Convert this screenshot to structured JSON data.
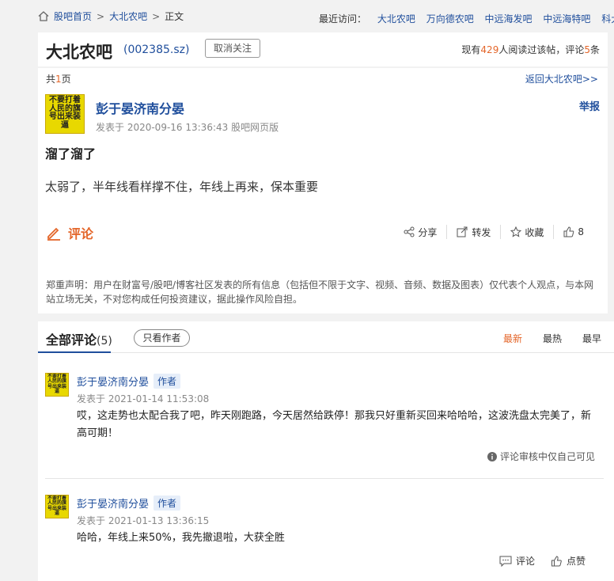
{
  "breadcrumb": {
    "home": "股吧首页",
    "bar": "大北农吧",
    "current": "正文",
    "sep": ">"
  },
  "recent": {
    "label": "最近访问：",
    "items": [
      "大北农吧",
      "万向德农吧",
      "中远海发吧",
      "中远海特吧",
      "科大智能"
    ]
  },
  "header": {
    "title": "大北农吧",
    "code": "(002385.sz)",
    "unfollow": "取消关注",
    "readers_prefix": "现有",
    "readers_count": "429",
    "readers_mid": "人阅读过该帖，评论",
    "comments_count": "5",
    "readers_suffix": "条"
  },
  "post": {
    "pages_prefix": "共",
    "pages_num": "1",
    "pages_suffix": "页",
    "back": "返回大北农吧>>",
    "avatar_text": "不要打着人民的旗号出来装逼",
    "author": "彭于晏济南分晏",
    "report": "举报",
    "posted": "发表于 2020-09-16 13:36:43 股吧网页版",
    "title": "溜了溜了",
    "body": "太弱了，半年线看样撑不住，年线上再来，保本重要",
    "comment": "评论",
    "share": "分享",
    "repost": "转发",
    "collect": "收藏",
    "likes": "8",
    "disclaimer": "郑重声明：用户在财富号/股吧/博客社区发表的所有信息（包括但不限于文字、视频、音频、数据及图表）仅代表个人观点，与本网站立场无关，不对您构成任何投资建议，据此操作风险自担。"
  },
  "comments": {
    "title": "全部评论",
    "count": "(5)",
    "author_only": "只看作者",
    "sort": [
      "最新",
      "最热",
      "最早"
    ],
    "items": [
      {
        "name": "彭于晏济南分晏",
        "tag": "作者",
        "time": "发表于 2021-01-14 11:53:08",
        "text": "哎，这走势也太配合我了吧，昨天刚跑路，今天居然给跌停！那我只好重新买回来哈哈哈，这波洗盘太完美了，新高可期！",
        "note": "评论审核中仅自己可见"
      },
      {
        "name": "彭于晏济南分晏",
        "tag": "作者",
        "time": "发表于 2021-01-13 13:36:15",
        "text": "哈哈，年线上来50%，我先撤退啦，大获全胜",
        "reply": "评论",
        "like": "点赞"
      }
    ]
  }
}
